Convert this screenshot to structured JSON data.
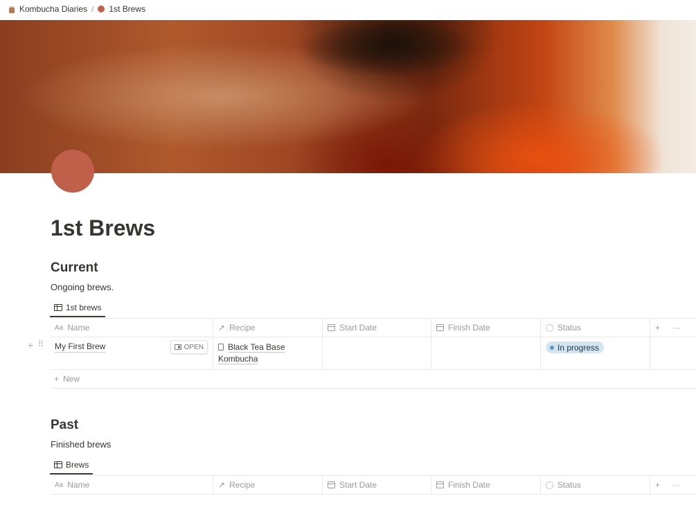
{
  "breadcrumb": {
    "workspace": "Kombucha Diaries",
    "separator": "/",
    "page": "1st Brews"
  },
  "page": {
    "title": "1st Brews",
    "icon_color": "#c0604a"
  },
  "sections": {
    "current": {
      "heading": "Current",
      "description": "Ongoing brews.",
      "view_tab": "1st brews",
      "columns": [
        "Name",
        "Recipe",
        "Start Date",
        "Finish Date",
        "Status"
      ],
      "rows": [
        {
          "name": "My First Brew",
          "open_label": "OPEN",
          "recipe": "Black Tea Base Kombucha",
          "start_date": "",
          "finish_date": "",
          "status": "In progress"
        }
      ],
      "new_label": "New"
    },
    "past": {
      "heading": "Past",
      "description": "Finished brews",
      "view_tab": "Brews",
      "columns": [
        "Name",
        "Recipe",
        "Start Date",
        "Finish Date",
        "Status"
      ]
    }
  },
  "icons": {
    "name_column": "Aa",
    "relation_column": "↗",
    "add": "+",
    "more": "···"
  }
}
